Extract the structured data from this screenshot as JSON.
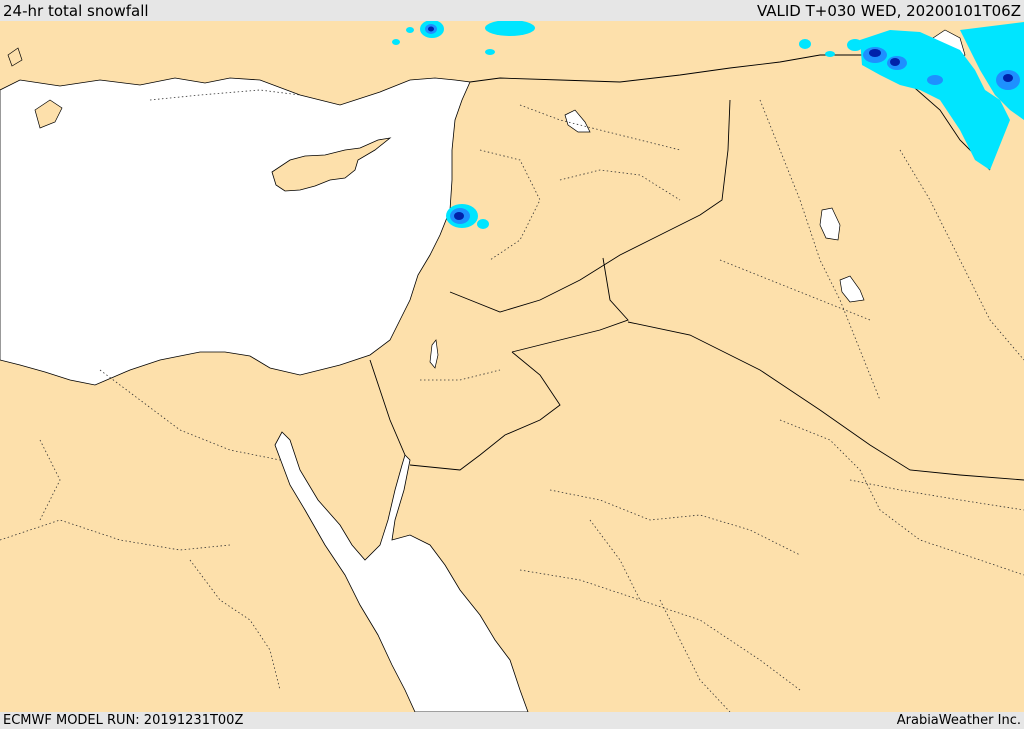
{
  "header": {
    "title": "24-hr total snowfall",
    "valid": "VALID T+030 WED, 20200101T06Z"
  },
  "footer": {
    "model_run": "ECMWF MODEL RUN: 20191231T00Z",
    "credit": "ArabiaWeather Inc."
  },
  "colors": {
    "land": "#fde0ab",
    "sea": "#ffffff",
    "snow_light": "#00e5ff",
    "snow_medium": "#1e90ff",
    "snow_heavy": "#0022aa",
    "header_bg": "#e6e6e6"
  }
}
